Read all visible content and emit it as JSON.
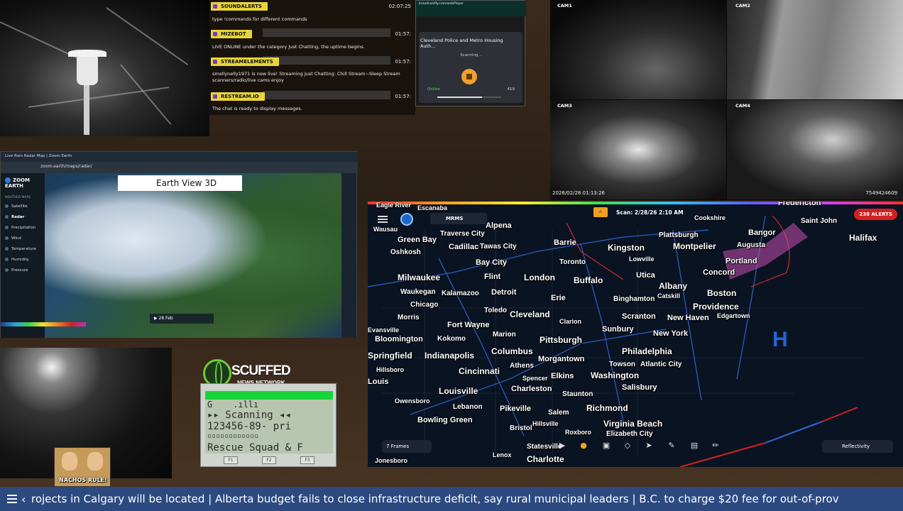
{
  "chat": {
    "messages": [
      {
        "user": "SOUNDALERTS",
        "time": "02:07:25",
        "text": "type !commands for different commands"
      },
      {
        "user": "MIZEBOT",
        "time": "01:57:",
        "text": "LIVE ONLINE under the category Just Chatting, the uptime begins."
      },
      {
        "user": "STREAMELEMENTS",
        "time": "01:57:",
        "text": "smellynelly1971 is now live! Streaming Just Chatting: Chill Stream~Sleep Stream scanners/radio/live cams enjoy"
      },
      {
        "user": "RESTREAM.IO",
        "time": "01:57:",
        "text": "The chat is ready to display messages."
      }
    ]
  },
  "player": {
    "title": "Cleveland Police and Metro Housing Auth...",
    "status": "Scanning...",
    "online": "Online",
    "listeners": "419",
    "progress_pct": 70
  },
  "cctv": {
    "labels": [
      "CAM1",
      "CAM2",
      "CAM3",
      "CAM4"
    ],
    "timestamp": "2026/02/28 01:13:26",
    "device_id": "7549424609"
  },
  "zoom_earth": {
    "logo": "ZOOM EARTH",
    "section": "WEATHER MAPS",
    "layers": [
      "Satellite",
      "Radar",
      "Precipitation",
      "Wind",
      "Temperature",
      "Humidity",
      "Pressure"
    ],
    "active_layer": "Radar",
    "badge": "Earth View 3D",
    "playback": "28 Feb"
  },
  "overlay": {
    "logo_title": "SCUFFED",
    "logo_sub": "NEWS NETWORK",
    "avatar_caption": "NACHOS RULE!"
  },
  "scanner": {
    "line1": "G    .ıllı",
    "line2": "▸▸ Scanning ◂◂",
    "line3": "123456-89- pri",
    "line4": "▫▫▫▫▫▫▫▫▫▫▫▫",
    "line5": "Rescue Squad & F",
    "keys": [
      "F1",
      "F2",
      "F3"
    ]
  },
  "radar": {
    "source": "MRMS",
    "scan_time": "Scan: 2/28/26 2:10 AM",
    "alerts": "238 ALERTS",
    "frames": "7 Frames",
    "product": "Reflectivity",
    "pressure_symbol": "H",
    "cities": [
      {
        "name": "Eagle River",
        "size": 9
      },
      {
        "name": "Escanaba",
        "size": 9
      },
      {
        "name": "Traverse City",
        "size": 10
      },
      {
        "name": "Alpena",
        "size": 11
      },
      {
        "name": "Wausau",
        "size": 9
      },
      {
        "name": "Green Bay",
        "size": 11
      },
      {
        "name": "Cadillac",
        "size": 11
      },
      {
        "name": "Tawas City",
        "size": 10
      },
      {
        "name": "Barrie",
        "size": 11
      },
      {
        "name": "Kingston",
        "size": 12
      },
      {
        "name": "Oshkosh",
        "size": 10
      },
      {
        "name": "Bay City",
        "size": 11
      },
      {
        "name": "Toronto",
        "size": 10
      },
      {
        "name": "Lowville",
        "size": 9
      },
      {
        "name": "Plattsburgh",
        "size": 10
      },
      {
        "name": "Montpelier",
        "size": 12
      },
      {
        "name": "Augusta",
        "size": 10
      },
      {
        "name": "Bangor",
        "size": 11
      },
      {
        "name": "Fredericton",
        "size": 11
      },
      {
        "name": "Saint John",
        "size": 10
      },
      {
        "name": "Halifax",
        "size": 12
      },
      {
        "name": "Milwaukee",
        "size": 12
      },
      {
        "name": "Flint",
        "size": 11
      },
      {
        "name": "London",
        "size": 12
      },
      {
        "name": "Buffalo",
        "size": 12
      },
      {
        "name": "Utica",
        "size": 11
      },
      {
        "name": "Portland",
        "size": 11
      },
      {
        "name": "Concord",
        "size": 11
      },
      {
        "name": "Waukegan",
        "size": 10
      },
      {
        "name": "Kalamazoo",
        "size": 10
      },
      {
        "name": "Detroit",
        "size": 11
      },
      {
        "name": "Erie",
        "size": 11
      },
      {
        "name": "Albany",
        "size": 12
      },
      {
        "name": "Boston",
        "size": 12
      },
      {
        "name": "Chicago",
        "size": 10
      },
      {
        "name": "Toledo",
        "size": 10
      },
      {
        "name": "Cleveland",
        "size": 12
      },
      {
        "name": "Binghamton",
        "size": 10
      },
      {
        "name": "Catskill",
        "size": 9
      },
      {
        "name": "Providence",
        "size": 12
      },
      {
        "name": "Morris",
        "size": 10
      },
      {
        "name": "Clarion",
        "size": 9
      },
      {
        "name": "Scranton",
        "size": 11
      },
      {
        "name": "New Haven",
        "size": 11
      },
      {
        "name": "Edgartown",
        "size": 9
      },
      {
        "name": "Fort Wayne",
        "size": 11
      },
      {
        "name": "Marion",
        "size": 10
      },
      {
        "name": "Sunbury",
        "size": 11
      },
      {
        "name": "New York",
        "size": 11
      },
      {
        "name": "Bloomington",
        "size": 11
      },
      {
        "name": "Kokomo",
        "size": 10
      },
      {
        "name": "Columbus",
        "size": 12
      },
      {
        "name": "Pittsburgh",
        "size": 12
      },
      {
        "name": "Philadelphia",
        "size": 12
      },
      {
        "name": "Springfield",
        "size": 12
      },
      {
        "name": "Indianapolis",
        "size": 12
      },
      {
        "name": "Athens",
        "size": 10
      },
      {
        "name": "Morgantown",
        "size": 11
      },
      {
        "name": "Atlantic City",
        "size": 10
      },
      {
        "name": "Towson",
        "size": 10
      },
      {
        "name": "Hillsboro",
        "size": 9
      },
      {
        "name": "Cincinnati",
        "size": 12
      },
      {
        "name": "Elkins",
        "size": 11
      },
      {
        "name": "Washington",
        "size": 12
      },
      {
        "name": "Spencer",
        "size": 9
      },
      {
        "name": "Charleston",
        "size": 11
      },
      {
        "name": "Salisbury",
        "size": 11
      },
      {
        "name": "Louis",
        "size": 11
      },
      {
        "name": "Louisville",
        "size": 12
      },
      {
        "name": "Staunton",
        "size": 10
      },
      {
        "name": "Lebanon",
        "size": 10
      },
      {
        "name": "Owensboro",
        "size": 9
      },
      {
        "name": "Pikeville",
        "size": 11
      },
      {
        "name": "Richmond",
        "size": 12
      },
      {
        "name": "Bowling Green",
        "size": 11
      },
      {
        "name": "Salem",
        "size": 10
      },
      {
        "name": "Hillsville",
        "size": 9
      },
      {
        "name": "Virginia Beach",
        "size": 12
      },
      {
        "name": "Bristol",
        "size": 10
      },
      {
        "name": "Roxboro",
        "size": 9
      },
      {
        "name": "Elizabeth City",
        "size": 10
      },
      {
        "name": "Statesville",
        "size": 10
      },
      {
        "name": "Charlotte",
        "size": 12
      },
      {
        "name": "Jonesboro",
        "size": 9
      },
      {
        "name": "Lenox",
        "size": 9
      },
      {
        "name": "Cookshire",
        "size": 9
      },
      {
        "name": "Evansville",
        "size": 9
      }
    ]
  },
  "ticker": {
    "text": "rojects in Calgary will be located  |  Alberta budget fails to close infrastructure deficit, say rural municipal leaders  |  B.C. to charge $20 fee for out-of-prov"
  },
  "colors": {
    "chat_user": "#e8d43a",
    "scanner_green": "#17d43a",
    "alerts_red": "#d42020",
    "ticker_blue": "#2c4a80",
    "radar_bg": "#0a1322"
  }
}
